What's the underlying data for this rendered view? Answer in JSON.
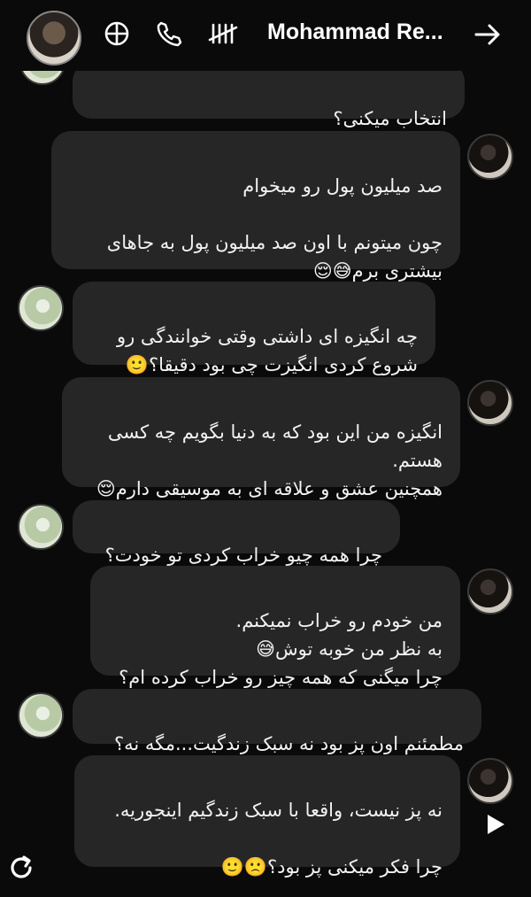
{
  "header": {
    "title": "Mohammad Re...",
    "icons": [
      "avatar",
      "threads-icon",
      "phone-icon",
      "tally-icon",
      "back-arrow-icon"
    ]
  },
  "messages": [
    {
      "sender": "them",
      "text": "انتخاب میکنی؟"
    },
    {
      "sender": "them_reply",
      "text": "صد میلیون پول رو میخوام\n\nچون میتونم با اون صد میلیون پول به جاهای بیشتری برم😅😌"
    },
    {
      "sender": "me",
      "text": "چه انگیزه ای داشتی وقتی خوانندگی رو شروع کردی انگیزت چی بود دقیقا؟🙂"
    },
    {
      "sender": "them_reply",
      "text": "انگیزه من این بود که به دنیا بگویم چه کسی هستم.\nهمچنین عشق و علاقه ای به موسیقی دارم😌"
    },
    {
      "sender": "me",
      "text": "چرا همه چیو خراب کردی تو خودت؟"
    },
    {
      "sender": "them_reply",
      "text": "من خودم رو خراب نمیکنم.\nبه نظر من خوبه توش😅\nچرا میگنی که همه چیز رو خراب کرده ام؟"
    },
    {
      "sender": "me",
      "text": "مطمئنم اون پز بود نه سبک زندگیت...مگه نه؟"
    },
    {
      "sender": "them_reply",
      "text": "نه پز نیست، واقعا با سبک زندگیم اینجوریه.\n\nچرا فکر میکنی پز بود؟🙁🙂"
    }
  ],
  "colors": {
    "background": "#0a0a0a",
    "bubble": "#262626",
    "text": "#f2f2f2"
  }
}
